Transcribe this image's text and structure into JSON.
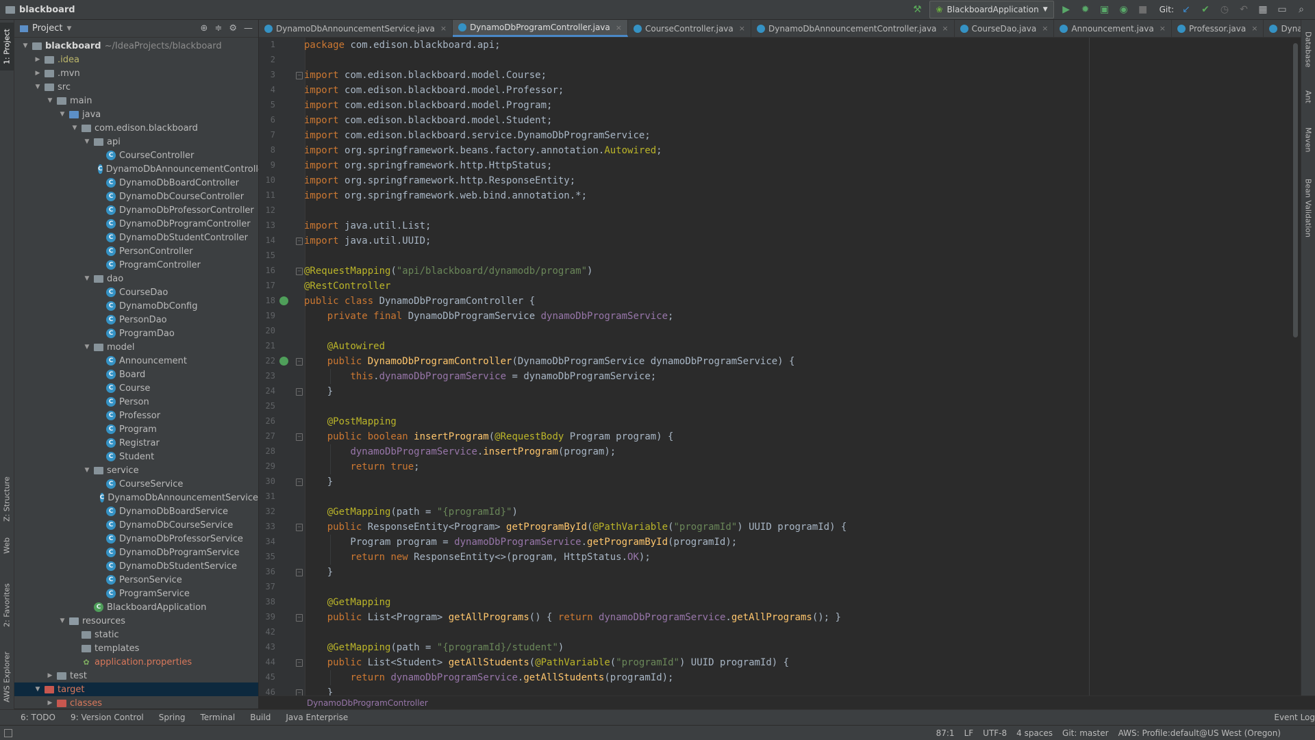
{
  "window": {
    "project_name": "blackboard",
    "run_config": "BlackboardApplication",
    "git_label": "Git:"
  },
  "project_panel": {
    "title": "Project",
    "tree": [
      {
        "label": "blackboard",
        "suffix": "~/IdeaProjects/blackboard",
        "depth": 0,
        "type": "folder",
        "open": true,
        "style": "bold"
      },
      {
        "label": ".idea",
        "depth": 1,
        "type": "folder",
        "open": false,
        "style": "yellow"
      },
      {
        "label": ".mvn",
        "depth": 1,
        "type": "folder",
        "open": false
      },
      {
        "label": "src",
        "depth": 1,
        "type": "folder",
        "open": true
      },
      {
        "label": "main",
        "depth": 2,
        "type": "folder",
        "open": true
      },
      {
        "label": "java",
        "depth": 3,
        "type": "srcfolder",
        "open": true
      },
      {
        "label": "com.edison.blackboard",
        "depth": 4,
        "type": "folder",
        "open": true
      },
      {
        "label": "api",
        "depth": 5,
        "type": "folder",
        "open": true
      },
      {
        "label": "CourseController",
        "depth": 6,
        "type": "class"
      },
      {
        "label": "DynamoDbAnnouncementController",
        "depth": 6,
        "type": "class"
      },
      {
        "label": "DynamoDbBoardController",
        "depth": 6,
        "type": "class"
      },
      {
        "label": "DynamoDbCourseController",
        "depth": 6,
        "type": "class"
      },
      {
        "label": "DynamoDbProfessorController",
        "depth": 6,
        "type": "class"
      },
      {
        "label": "DynamoDbProgramController",
        "depth": 6,
        "type": "class"
      },
      {
        "label": "DynamoDbStudentController",
        "depth": 6,
        "type": "class"
      },
      {
        "label": "PersonController",
        "depth": 6,
        "type": "class"
      },
      {
        "label": "ProgramController",
        "depth": 6,
        "type": "class"
      },
      {
        "label": "dao",
        "depth": 5,
        "type": "folder",
        "open": true
      },
      {
        "label": "CourseDao",
        "depth": 6,
        "type": "class"
      },
      {
        "label": "DynamoDbConfig",
        "depth": 6,
        "type": "class"
      },
      {
        "label": "PersonDao",
        "depth": 6,
        "type": "class"
      },
      {
        "label": "ProgramDao",
        "depth": 6,
        "type": "class"
      },
      {
        "label": "model",
        "depth": 5,
        "type": "folder",
        "open": true
      },
      {
        "label": "Announcement",
        "depth": 6,
        "type": "class"
      },
      {
        "label": "Board",
        "depth": 6,
        "type": "class"
      },
      {
        "label": "Course",
        "depth": 6,
        "type": "class"
      },
      {
        "label": "Person",
        "depth": 6,
        "type": "class"
      },
      {
        "label": "Professor",
        "depth": 6,
        "type": "class"
      },
      {
        "label": "Program",
        "depth": 6,
        "type": "class"
      },
      {
        "label": "Registrar",
        "depth": 6,
        "type": "class"
      },
      {
        "label": "Student",
        "depth": 6,
        "type": "class"
      },
      {
        "label": "service",
        "depth": 5,
        "type": "folder",
        "open": true
      },
      {
        "label": "CourseService",
        "depth": 6,
        "type": "class"
      },
      {
        "label": "DynamoDbAnnouncementService",
        "depth": 6,
        "type": "class"
      },
      {
        "label": "DynamoDbBoardService",
        "depth": 6,
        "type": "class"
      },
      {
        "label": "DynamoDbCourseService",
        "depth": 6,
        "type": "class"
      },
      {
        "label": "DynamoDbProfessorService",
        "depth": 6,
        "type": "class"
      },
      {
        "label": "DynamoDbProgramService",
        "depth": 6,
        "type": "class"
      },
      {
        "label": "DynamoDbStudentService",
        "depth": 6,
        "type": "class"
      },
      {
        "label": "PersonService",
        "depth": 6,
        "type": "class"
      },
      {
        "label": "ProgramService",
        "depth": 6,
        "type": "class"
      },
      {
        "label": "BlackboardApplication",
        "depth": 5,
        "type": "appclass"
      },
      {
        "label": "resources",
        "depth": 3,
        "type": "resfolder",
        "open": true
      },
      {
        "label": "static",
        "depth": 4,
        "type": "folder"
      },
      {
        "label": "templates",
        "depth": 4,
        "type": "folder"
      },
      {
        "label": "application.properties",
        "depth": 4,
        "type": "props",
        "style": "orange"
      },
      {
        "label": "test",
        "depth": 2,
        "type": "folder",
        "open": false
      },
      {
        "label": "target",
        "depth": 1,
        "type": "excluded",
        "open": true,
        "style": "orange",
        "selected": true
      },
      {
        "label": "classes",
        "depth": 2,
        "type": "excluded",
        "open": false,
        "style": "orange"
      }
    ]
  },
  "tabs": [
    {
      "label": "DynamoDbAnnouncementService.java",
      "active": false
    },
    {
      "label": "DynamoDbProgramController.java",
      "active": true
    },
    {
      "label": "CourseController.java",
      "active": false
    },
    {
      "label": "DynamoDbAnnouncementController.java",
      "active": false
    },
    {
      "label": "CourseDao.java",
      "active": false
    },
    {
      "label": "Announcement.java",
      "active": false
    },
    {
      "label": "Professor.java",
      "active": false
    },
    {
      "label": "DynamoDbCourseController.java",
      "active": false
    }
  ],
  "tabs_overflow": "2",
  "editor": {
    "line_numbers": [
      "1",
      "2",
      "3",
      "4",
      "5",
      "6",
      "7",
      "8",
      "9",
      "10",
      "11",
      "12",
      "13",
      "14",
      "15",
      "16",
      "17",
      "18",
      "19",
      "20",
      "21",
      "22",
      "23",
      "24",
      "25",
      "26",
      "27",
      "28",
      "29",
      "30",
      "31",
      "32",
      "33",
      "34",
      "35",
      "36",
      "37",
      "38",
      "39",
      "42",
      "43",
      "44",
      "45",
      "46"
    ],
    "lines": [
      [
        [
          "kw",
          "package "
        ],
        [
          "typ",
          "com.edison.blackboard.api;"
        ]
      ],
      [],
      [
        [
          "kw",
          "import "
        ],
        [
          "typ",
          "com.edison.blackboard.model.Course;"
        ]
      ],
      [
        [
          "kw",
          "import "
        ],
        [
          "typ",
          "com.edison.blackboard.model.Professor;"
        ]
      ],
      [
        [
          "kw",
          "import "
        ],
        [
          "typ",
          "com.edison.blackboard.model.Program;"
        ]
      ],
      [
        [
          "kw",
          "import "
        ],
        [
          "typ",
          "com.edison.blackboard.model.Student;"
        ]
      ],
      [
        [
          "kw",
          "import "
        ],
        [
          "typ",
          "com.edison.blackboard.service.DynamoDbProgramService;"
        ]
      ],
      [
        [
          "kw",
          "import "
        ],
        [
          "typ",
          "org.springframework.beans.factory.annotation."
        ],
        [
          "ann",
          "Autowired"
        ],
        [
          "typ",
          ";"
        ]
      ],
      [
        [
          "kw",
          "import "
        ],
        [
          "typ",
          "org.springframework.http.HttpStatus;"
        ]
      ],
      [
        [
          "kw",
          "import "
        ],
        [
          "typ",
          "org.springframework.http.ResponseEntity;"
        ]
      ],
      [
        [
          "kw",
          "import "
        ],
        [
          "typ",
          "org.springframework.web.bind.annotation.*;"
        ]
      ],
      [],
      [
        [
          "kw",
          "import "
        ],
        [
          "typ",
          "java.util.List;"
        ]
      ],
      [
        [
          "kw",
          "import "
        ],
        [
          "typ",
          "java.util.UUID;"
        ]
      ],
      [],
      [
        [
          "ann",
          "@RequestMapping"
        ],
        [
          "typ",
          "("
        ],
        [
          "str",
          "\"api/blackboard/dynamodb/program\""
        ],
        [
          "typ",
          ")"
        ]
      ],
      [
        [
          "ann",
          "@RestController"
        ]
      ],
      [
        [
          "kw",
          "public class "
        ],
        [
          "typ",
          "DynamoDbProgramController {"
        ]
      ],
      [
        [
          "typ",
          "    "
        ],
        [
          "kw",
          "private final "
        ],
        [
          "typ",
          "DynamoDbProgramService "
        ],
        [
          "fld",
          "dynamoDbProgramService"
        ],
        [
          "typ",
          ";"
        ]
      ],
      [],
      [
        [
          "typ",
          "    "
        ],
        [
          "ann",
          "@Autowired"
        ]
      ],
      [
        [
          "typ",
          "    "
        ],
        [
          "kw",
          "public "
        ],
        [
          "fn",
          "DynamoDbProgramController"
        ],
        [
          "typ",
          "(DynamoDbProgramService dynamoDbProgramService) {"
        ]
      ],
      [
        [
          "typ",
          "        "
        ],
        [
          "kw",
          "this"
        ],
        [
          "typ",
          "."
        ],
        [
          "fld",
          "dynamoDbProgramService"
        ],
        [
          "typ",
          " = dynamoDbProgramService;"
        ]
      ],
      [
        [
          "typ",
          "    }"
        ]
      ],
      [],
      [
        [
          "typ",
          "    "
        ],
        [
          "ann",
          "@PostMapping"
        ]
      ],
      [
        [
          "typ",
          "    "
        ],
        [
          "kw",
          "public boolean "
        ],
        [
          "fn",
          "insertProgram"
        ],
        [
          "typ",
          "("
        ],
        [
          "ann",
          "@RequestBody "
        ],
        [
          "typ",
          "Program program) {"
        ]
      ],
      [
        [
          "typ",
          "        "
        ],
        [
          "fld",
          "dynamoDbProgramService"
        ],
        [
          "typ",
          "."
        ],
        [
          "fn",
          "insertProgram"
        ],
        [
          "typ",
          "(program);"
        ]
      ],
      [
        [
          "typ",
          "        "
        ],
        [
          "kw",
          "return true"
        ],
        [
          "typ",
          ";"
        ]
      ],
      [
        [
          "typ",
          "    }"
        ]
      ],
      [],
      [
        [
          "typ",
          "    "
        ],
        [
          "ann",
          "@GetMapping"
        ],
        [
          "typ",
          "(path = "
        ],
        [
          "str",
          "\"{programId}\""
        ],
        [
          "typ",
          ")"
        ]
      ],
      [
        [
          "typ",
          "    "
        ],
        [
          "kw",
          "public "
        ],
        [
          "typ",
          "ResponseEntity<Program> "
        ],
        [
          "fn",
          "getProgramById"
        ],
        [
          "typ",
          "("
        ],
        [
          "ann",
          "@PathVariable"
        ],
        [
          "typ",
          "("
        ],
        [
          "str",
          "\"programId\""
        ],
        [
          "typ",
          ") UUID programId) {"
        ]
      ],
      [
        [
          "typ",
          "        Program program = "
        ],
        [
          "fld",
          "dynamoDbProgramService"
        ],
        [
          "typ",
          "."
        ],
        [
          "fn",
          "getProgramById"
        ],
        [
          "typ",
          "(programId);"
        ]
      ],
      [
        [
          "typ",
          "        "
        ],
        [
          "kw",
          "return new "
        ],
        [
          "typ",
          "ResponseEntity<>(program, HttpStatus."
        ],
        [
          "fld",
          "OK"
        ],
        [
          "typ",
          ");"
        ]
      ],
      [
        [
          "typ",
          "    }"
        ]
      ],
      [],
      [
        [
          "typ",
          "    "
        ],
        [
          "ann",
          "@GetMapping"
        ]
      ],
      [
        [
          "typ",
          "    "
        ],
        [
          "kw",
          "public "
        ],
        [
          "typ",
          "List<Program> "
        ],
        [
          "fn",
          "getAllPrograms"
        ],
        [
          "typ",
          "() { "
        ],
        [
          "kw",
          "return "
        ],
        [
          "fld",
          "dynamoDbProgramService"
        ],
        [
          "typ",
          "."
        ],
        [
          "fn",
          "getAllPrograms"
        ],
        [
          "typ",
          "(); }"
        ]
      ],
      [],
      [
        [
          "typ",
          "    "
        ],
        [
          "ann",
          "@GetMapping"
        ],
        [
          "typ",
          "(path = "
        ],
        [
          "str",
          "\"{programId}/student\""
        ],
        [
          "typ",
          ")"
        ]
      ],
      [
        [
          "typ",
          "    "
        ],
        [
          "kw",
          "public "
        ],
        [
          "typ",
          "List<Student> "
        ],
        [
          "fn",
          "getAllStudents"
        ],
        [
          "typ",
          "("
        ],
        [
          "ann",
          "@PathVariable"
        ],
        [
          "typ",
          "("
        ],
        [
          "str",
          "\"programId\""
        ],
        [
          "typ",
          ") UUID programId) {"
        ]
      ],
      [
        [
          "typ",
          "        "
        ],
        [
          "kw",
          "return "
        ],
        [
          "fld",
          "dynamoDbProgramService"
        ],
        [
          "typ",
          "."
        ],
        [
          "fn",
          "getAllStudents"
        ],
        [
          "typ",
          "(programId);"
        ]
      ],
      [
        [
          "typ",
          "    }"
        ]
      ]
    ],
    "breadcrumb": "DynamoDbProgramController"
  },
  "left_strip": {
    "project": "1: Project",
    "structure": "Z: Structure",
    "web": "Web",
    "favorites": "2: Favorites",
    "aws": "AWS Explorer"
  },
  "right_strip": {
    "database": "Database",
    "ant": "Ant",
    "maven": "Maven",
    "bean": "Bean Validation"
  },
  "bottom_tools": [
    "6: TODO",
    "9: Version Control",
    "Spring",
    "Terminal",
    "Build",
    "Java Enterprise"
  ],
  "event_log": "Event Log",
  "status": {
    "position": "87:1",
    "line_sep": "LF",
    "encoding": "UTF-8",
    "indent": "4 spaces",
    "branch": "Git: master",
    "aws": "AWS: Profile:default@US West (Oregon)"
  },
  "colors": {
    "accent": "#4a88c7",
    "bg": "#2b2b2b",
    "panel": "#3c3f41",
    "keyword": "#cc7832",
    "annotation": "#bbb529",
    "string": "#6a8759",
    "field": "#9876aa",
    "method": "#ffc66d"
  }
}
